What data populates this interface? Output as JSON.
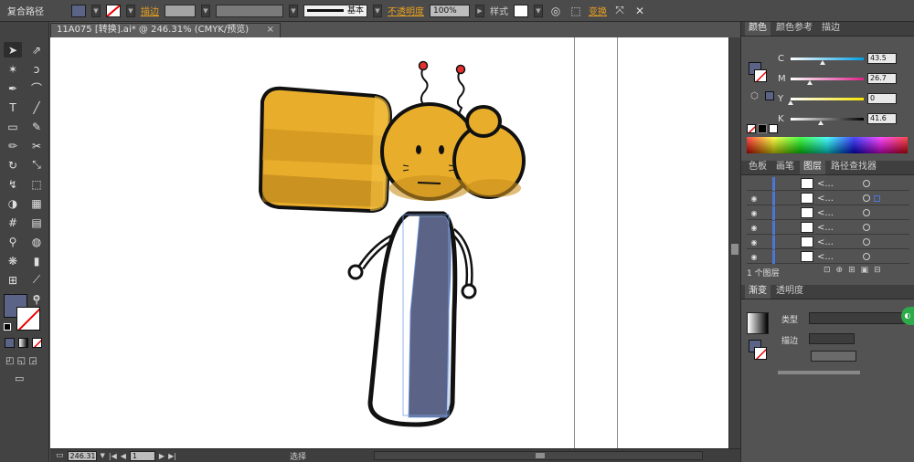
{
  "control_bar": {
    "title": "复合路径",
    "stroke_label": "描边",
    "stroke_preset": "基本",
    "opacity_label": "不透明度",
    "opacity_value": "100%",
    "style_label": "样式",
    "transform_label": "变换",
    "fill_color": "#5b6486"
  },
  "document": {
    "tab_title": "11A075 [转换].ai* @ 246.31% (CMYK/预览)",
    "close_glyph": "×"
  },
  "status_bar": {
    "zoom": "246.31",
    "page": "1",
    "tool": "选择"
  },
  "color_panel": {
    "tabs": [
      "颜色",
      "颜色参考",
      "描边"
    ],
    "channels": [
      {
        "name": "C",
        "value": "43.5",
        "fraction": 0.435,
        "gradient_end": "#00a0e8"
      },
      {
        "name": "M",
        "value": "26.7",
        "fraction": 0.267,
        "gradient_end": "#e0208a"
      },
      {
        "name": "Y",
        "value": "0",
        "fraction": 0.0,
        "gradient_end": "#f5e400"
      },
      {
        "name": "K",
        "value": "41.6",
        "fraction": 0.416,
        "gradient_end": "#000000"
      }
    ]
  },
  "layers_panel": {
    "tabs": [
      "色板",
      "画笔",
      "图层",
      "路径查找器"
    ],
    "rows": [
      {
        "name": "<...",
        "visible": false
      },
      {
        "name": "<...",
        "visible": true
      },
      {
        "name": "<...",
        "visible": true
      },
      {
        "name": "<...",
        "visible": true
      },
      {
        "name": "<...",
        "visible": true
      },
      {
        "name": "<...",
        "visible": true
      }
    ],
    "footer": "1 个图层"
  },
  "gradient_panel": {
    "tabs": [
      "渐变",
      "透明度"
    ],
    "type_label": "类型",
    "stroke_label": "描边"
  }
}
